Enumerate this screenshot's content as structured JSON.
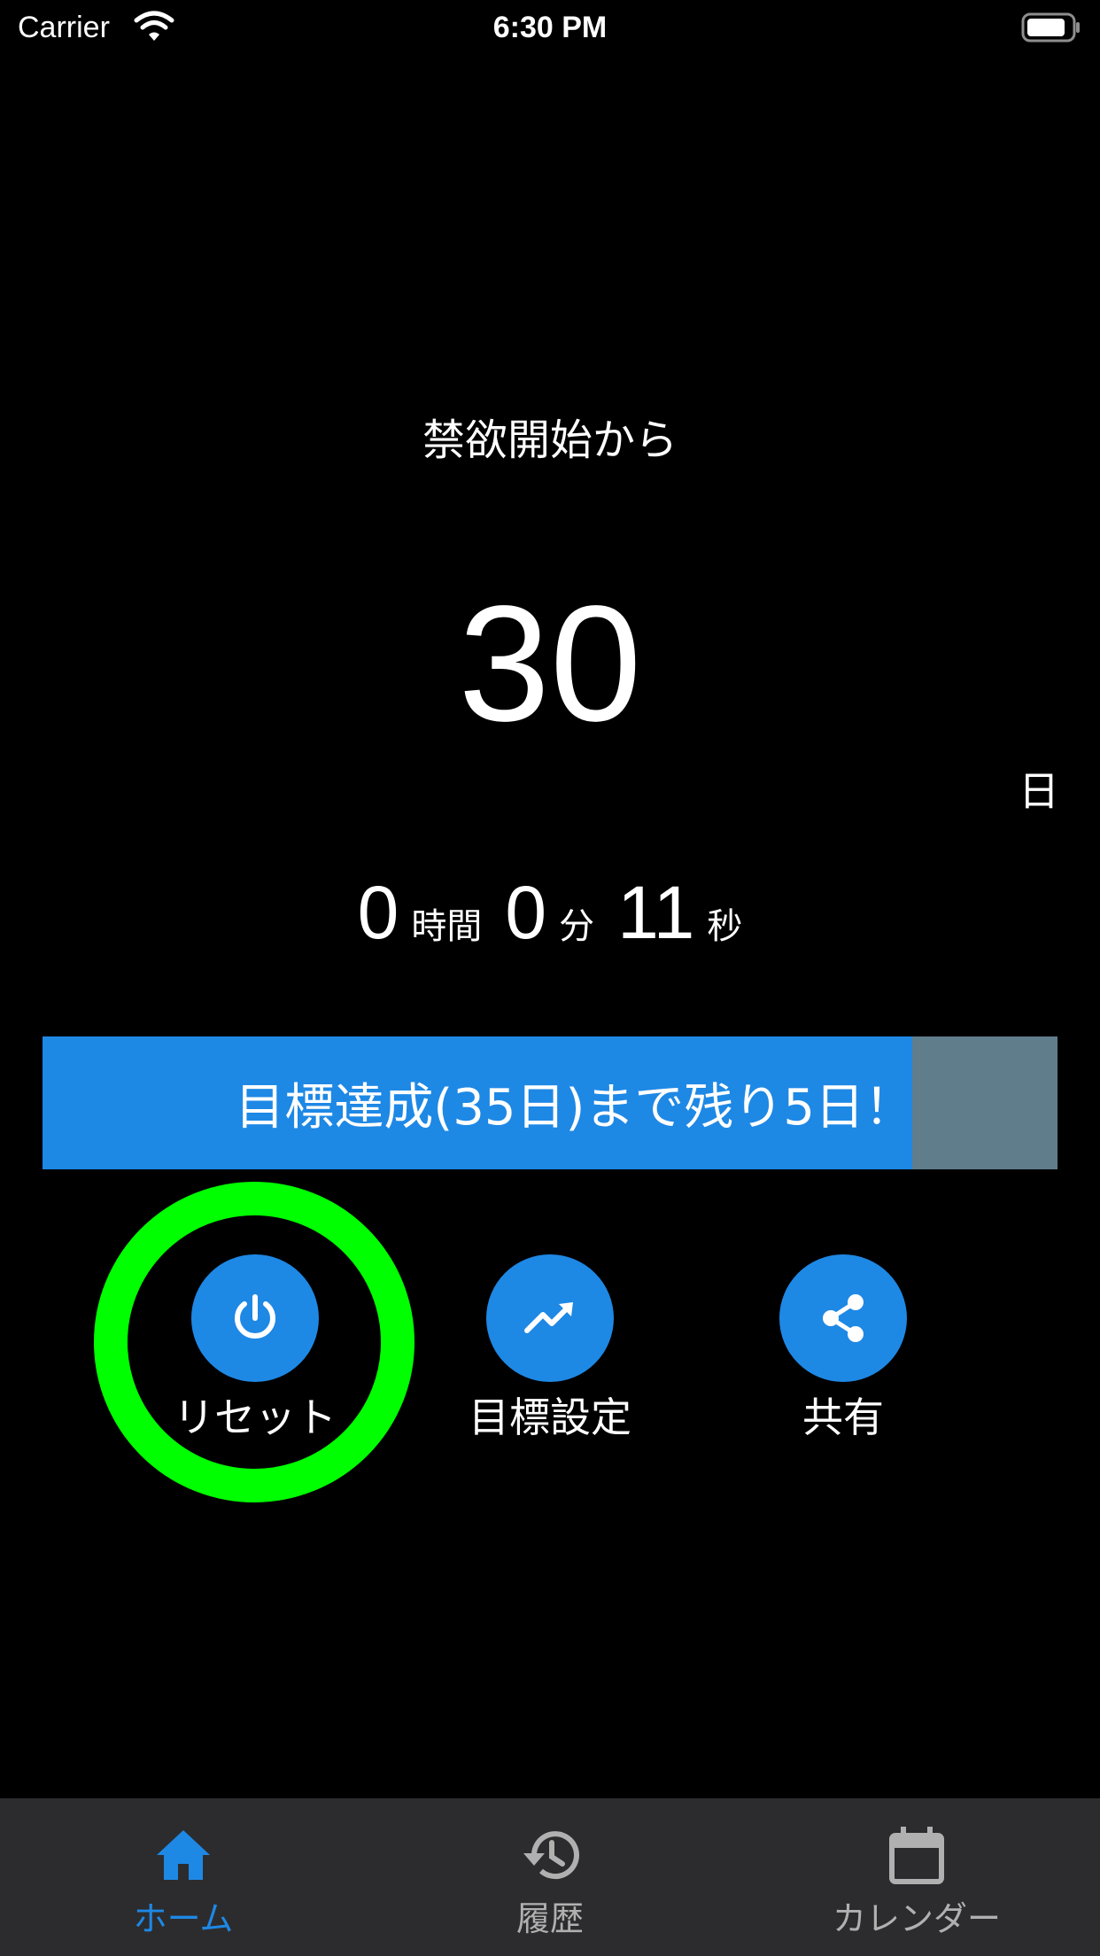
{
  "status_bar": {
    "carrier": "Carrier",
    "time": "6:30 PM",
    "wifi_icon": "wifi-icon",
    "battery_icon": "battery-icon"
  },
  "counter": {
    "since_label": "禁欲開始から",
    "days": "30",
    "days_unit": "日",
    "hours": "0",
    "hours_unit": "時間",
    "minutes": "0",
    "minutes_unit": "分",
    "seconds": "11",
    "seconds_unit": "秒"
  },
  "goal": {
    "text": "目標達成(35日)まで残り5日！",
    "progress": 0.857,
    "fill_color": "#1e88e5",
    "track_color": "#607d8b"
  },
  "actions": [
    {
      "label": "リセット",
      "icon": "power-icon"
    },
    {
      "label": "目標設定",
      "icon": "trending-up-icon"
    },
    {
      "label": "共有",
      "icon": "share-icon"
    }
  ],
  "highlight_color": "#00ff00",
  "tabs": [
    {
      "label": "ホーム",
      "icon": "home-icon",
      "active": true
    },
    {
      "label": "履歴",
      "icon": "history-icon",
      "active": false
    },
    {
      "label": "カレンダー",
      "icon": "calendar-icon",
      "active": false
    }
  ],
  "colors": {
    "accent": "#1e88e5",
    "background": "#000000",
    "tab_bar": "#2c2c2e",
    "tab_inactive": "#b0b0b0"
  }
}
